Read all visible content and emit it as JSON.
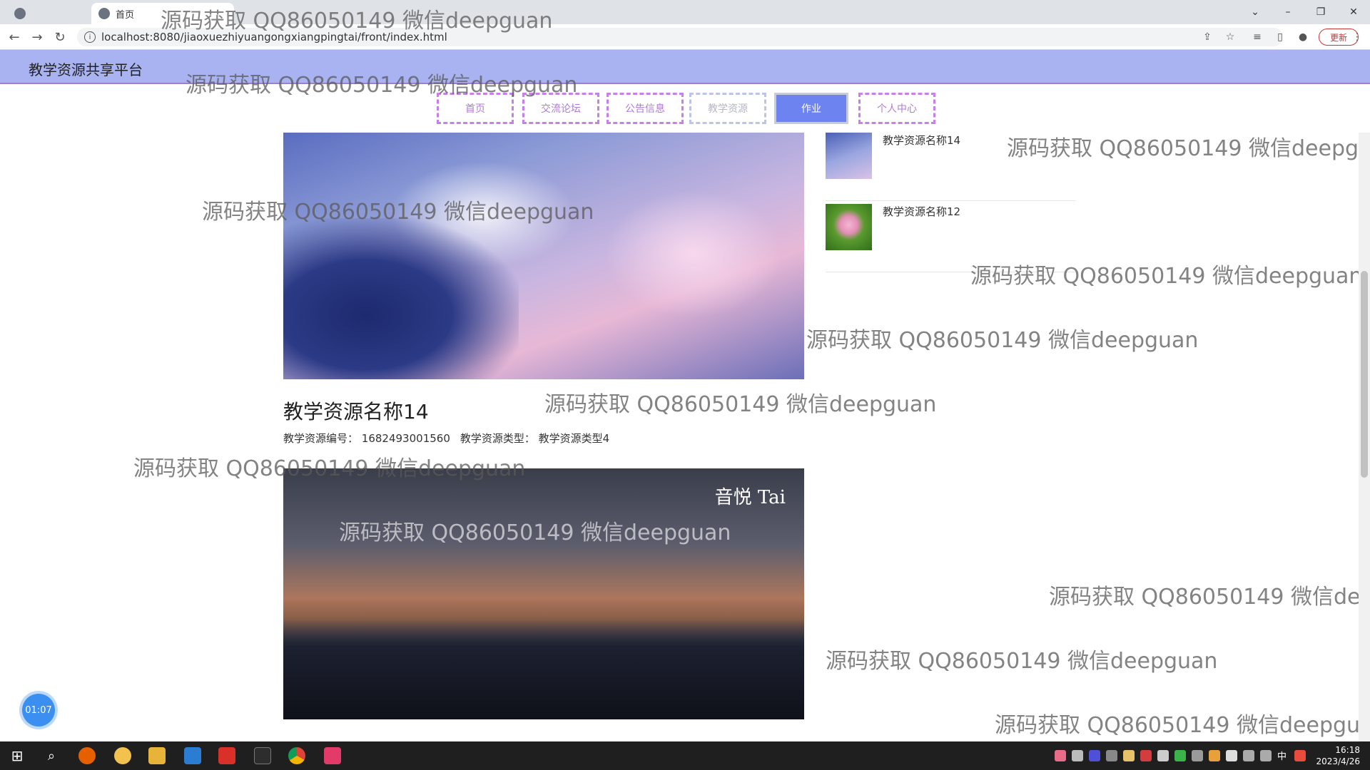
{
  "browser": {
    "tabs": [
      {
        "label": "首页",
        "active": true
      }
    ],
    "url": "localhost:8080/jiaoxuezhiyuangongxiangpingtai/front/index.html",
    "update_label": "更新",
    "window_controls": [
      "⌄",
      "–",
      "❐",
      "✕"
    ]
  },
  "site": {
    "title": "教学资源共享平台",
    "nav": [
      {
        "label": "首页"
      },
      {
        "label": "交流论坛"
      },
      {
        "label": "公告信息"
      },
      {
        "label": "教学资源"
      },
      {
        "label": "作业"
      },
      {
        "label": "个人中心"
      }
    ]
  },
  "resource": {
    "title": "教学资源名称14",
    "meta": {
      "code_label": "教学资源编号：",
      "code_value": "1682493001560",
      "type_label": "教学资源类型：",
      "type_value": "教学资源类型4"
    },
    "video_caption": "音悦 Tai"
  },
  "sidebar": {
    "items": [
      {
        "label": "教学资源名称14"
      },
      {
        "label": "教学资源名称12"
      }
    ]
  },
  "timer": "01:07",
  "watermark_text": "源码获取 QQ86050149 微信deepguan",
  "taskbar": {
    "time": "16:18",
    "date": "2023/4/26",
    "ime": "中"
  }
}
